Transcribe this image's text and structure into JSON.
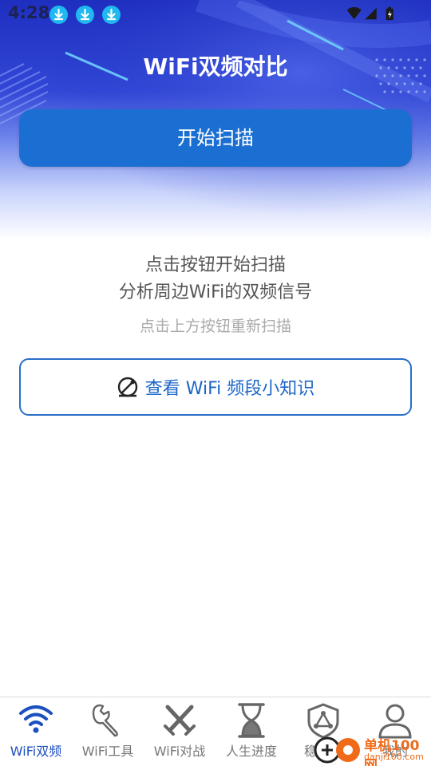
{
  "status_bar": {
    "time": "4:28"
  },
  "app": {
    "title": "WiFi双频对比"
  },
  "main": {
    "scan_button_label": "开始扫描",
    "prompt_line1": "点击按钮开始扫描",
    "prompt_line2": "分析周边WiFi的双频信号",
    "hint": "点击上方按钮重新扫描",
    "knowledge_button_label": "查看 WiFi 频段小知识"
  },
  "bottom_nav": {
    "items": [
      {
        "label": "WiFi双频",
        "icon": "wifi-icon",
        "active": true
      },
      {
        "label": "WiFi工具",
        "icon": "wrench-icon",
        "active": false
      },
      {
        "label": "WiFi对战",
        "icon": "crossed-swords-icon",
        "active": false
      },
      {
        "label": "人生进度",
        "icon": "hourglass-icon",
        "active": false
      },
      {
        "label": "稳定性",
        "icon": "shield-icon",
        "active": false
      },
      {
        "label": "我的",
        "icon": "person-icon",
        "active": false
      }
    ]
  },
  "watermark": {
    "line1": "单机100网",
    "line2": "danji100.com"
  },
  "colors": {
    "primary": "#1c6fd2",
    "hero_top": "#1e2fc0",
    "active_nav": "#1c4fc0",
    "inactive_nav": "#777777"
  }
}
